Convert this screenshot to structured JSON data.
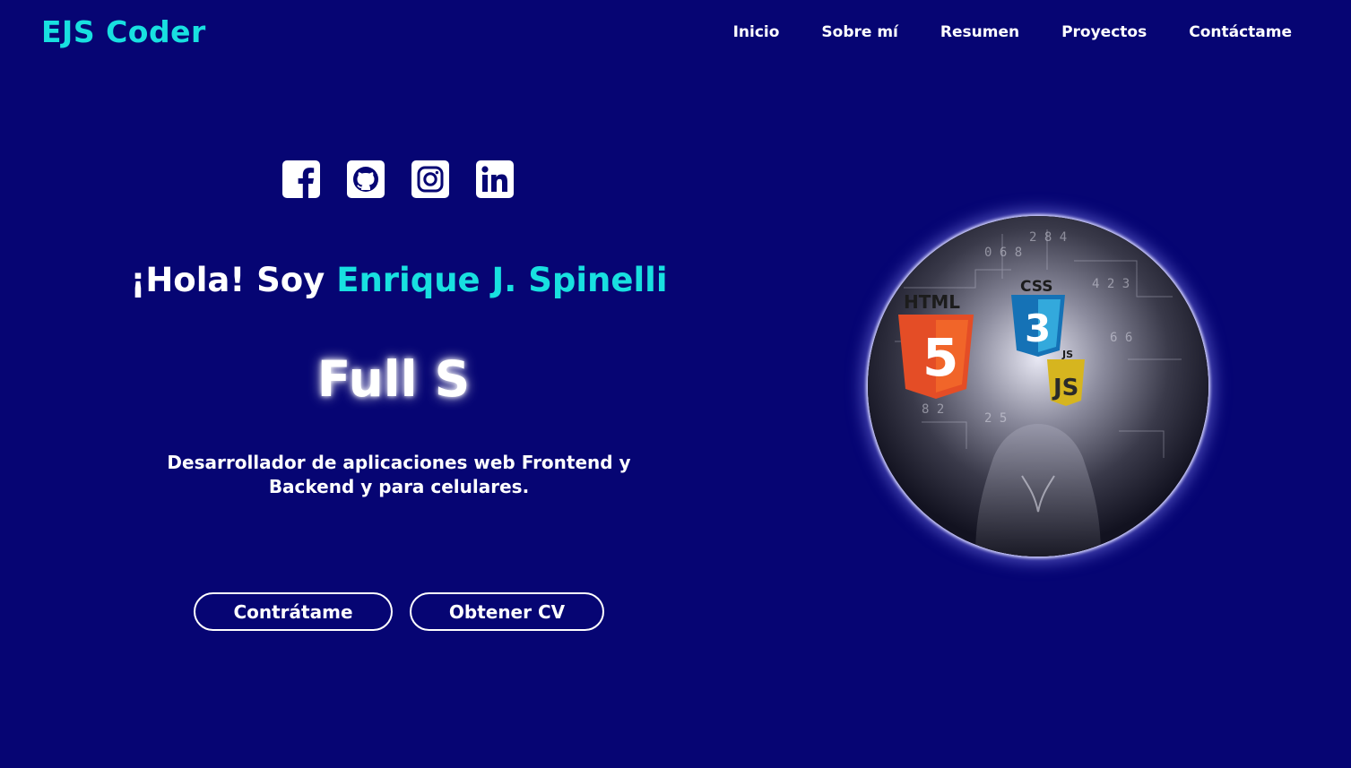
{
  "header": {
    "logo": "EJS Coder",
    "nav": [
      "Inicio",
      "Sobre mí",
      "Resumen",
      "Proyectos",
      "Contáctame"
    ]
  },
  "socials": [
    {
      "icon": "facebook-icon"
    },
    {
      "icon": "github-icon"
    },
    {
      "icon": "instagram-icon"
    },
    {
      "icon": "linkedin-icon"
    }
  ],
  "hero": {
    "greeting_prefix": "¡Hola! Soy ",
    "name": "Enrique J. Spinelli",
    "role_typed": "Full S",
    "description": "Desarrollador de aplicaciones web Frontend y Backend y para celulares.",
    "buttons": {
      "hire": "Contrátame",
      "cv": "Obtener CV"
    }
  },
  "portrait": {
    "html_label": "HTML",
    "html_digit": "5",
    "css_label": "CSS",
    "css_digit": "3",
    "js_label": "JS",
    "js_mark": "JS"
  },
  "colors": {
    "background": "#060573",
    "accent": "#18e0e0",
    "text": "#ffffff"
  }
}
